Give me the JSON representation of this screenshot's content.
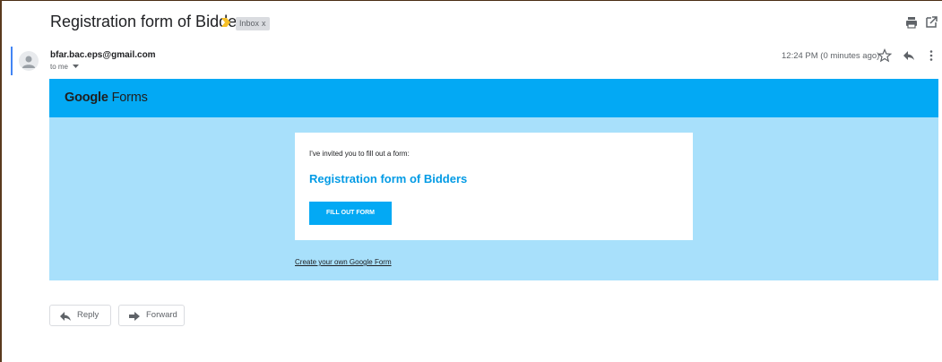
{
  "email": {
    "subject": "Registration form of Bidders",
    "label_chip": "Inbox",
    "label_chip_close": "x",
    "sender": "bfar.bac.eps@gmail.com",
    "recipient": "to me",
    "timestamp": "12:24 PM (0 minutes ago)"
  },
  "form_email": {
    "logo_google": "Google",
    "logo_forms": "Forms",
    "invite_text": "I've invited you to fill out a form:",
    "form_title": "Registration form of Bidders",
    "button_label": "FILL OUT FORM",
    "create_link": "Create your own Google Form"
  },
  "actions": {
    "reply_label": "Reply",
    "forward_label": "Forward"
  },
  "icons": {
    "importance": "importance-marker-icon",
    "print": "print-icon",
    "new_window": "open-in-new-window-icon",
    "avatar": "person-icon",
    "star": "star-icon",
    "reply": "reply-icon",
    "more": "more-vert-icon",
    "forward": "forward-icon"
  },
  "colors": {
    "banner": "#03a9f4",
    "body": "#a8e0fb",
    "title": "#039be5",
    "importance": "#f6bf26",
    "selection": "#4285f4"
  }
}
